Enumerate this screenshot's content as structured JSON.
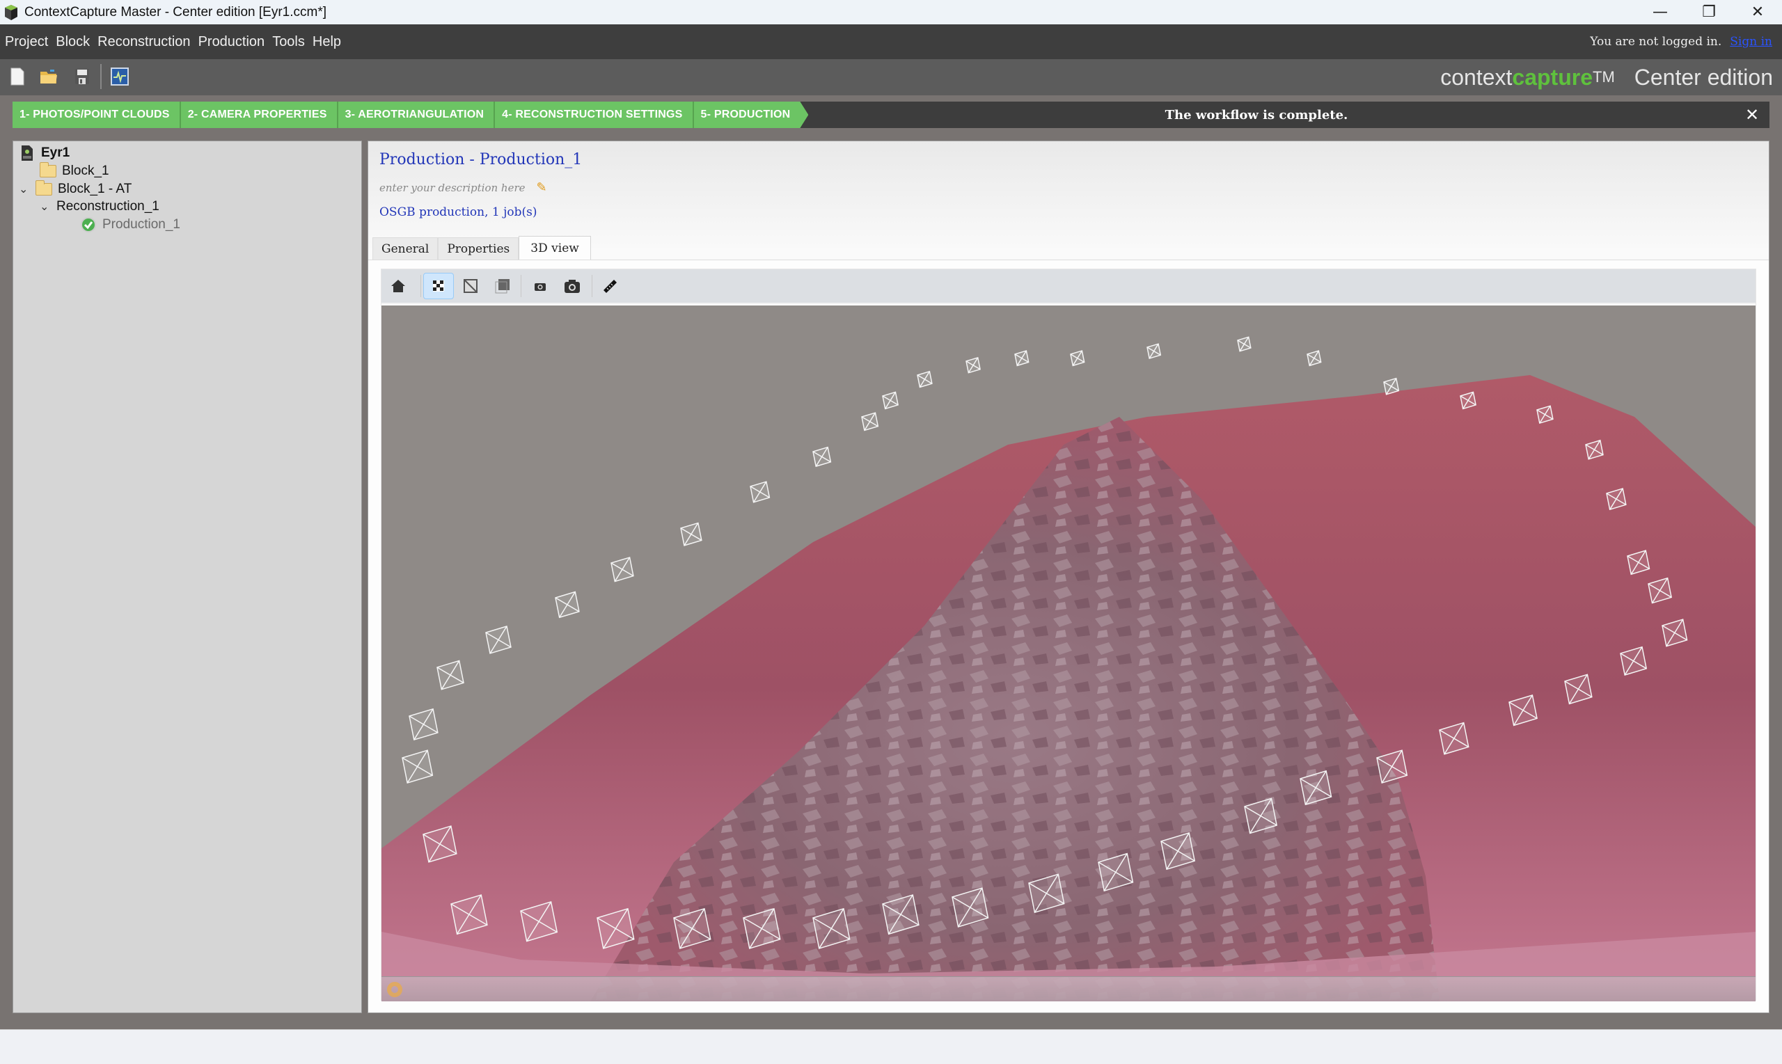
{
  "window": {
    "title": "ContextCapture Master - Center edition [Eyr1.ccm*]",
    "controls": {
      "minimize": "—",
      "restore": "❐",
      "close": "✕"
    }
  },
  "menubar": {
    "items": [
      "Project",
      "Block",
      "Reconstruction",
      "Production",
      "Tools",
      "Help"
    ],
    "login_text": "You are not logged in.",
    "sign_in": "Sign in"
  },
  "toolbar": {
    "buttons": [
      "new-project-icon",
      "open-project-icon",
      "save-project-icon",
      "job-monitor-icon"
    ]
  },
  "brand": {
    "part1": "context",
    "part2": "capture",
    "tm": "TM",
    "edition": "Center edition",
    "accent_color": "#5fc13d"
  },
  "workflow": {
    "steps": [
      "1- PHOTOS/POINT CLOUDS",
      "2- CAMERA PROPERTIES",
      "3- AEROTRIANGULATION",
      "4- RECONSTRUCTION SETTINGS",
      "5- PRODUCTION"
    ],
    "step_color": "#6cc464",
    "message": "The workflow is complete.",
    "close": "✕"
  },
  "tree": {
    "root": "Eyr1",
    "items": [
      {
        "label": "Block_1",
        "type": "block"
      },
      {
        "label": "Block_1 - AT",
        "type": "block",
        "expanded": true
      },
      {
        "label": "Reconstruction_1",
        "type": "reconstruction",
        "expanded": true
      },
      {
        "label": "Production_1",
        "type": "production",
        "status": "complete"
      }
    ],
    "expand_glyph": "⌄"
  },
  "production": {
    "title": "Production - Production_1",
    "description_placeholder": "enter your description here",
    "info": "OSGB production, 1 job(s)",
    "tabs": [
      "General",
      "Properties",
      "3D view"
    ],
    "active_tab": "3D view"
  },
  "view_toolbar": {
    "buttons": [
      "home-icon",
      "textured-mesh-icon",
      "wireframe-icon",
      "bounding-box-icon",
      "photos-small-icon",
      "photos-large-icon",
      "measure-icon"
    ],
    "active": "textured-mesh-icon"
  },
  "scene": {
    "sky_color": "#8f8a87",
    "terrain_color": "#a85a6e",
    "camera_color": "#ffffff"
  }
}
